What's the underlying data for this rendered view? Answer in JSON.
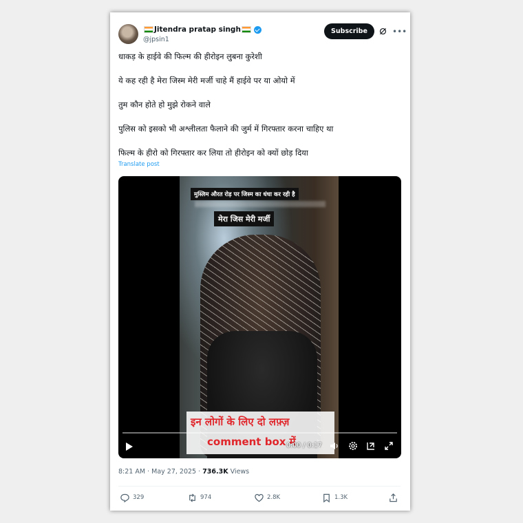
{
  "author": {
    "display_name": "Jitendra pratap singh",
    "handle": "@jpsin1",
    "verified": true
  },
  "subscribe_label": "Subscribe",
  "post": {
    "lines": [
      "धाकड़ के हाईवे की फिल्म की हीरोइन लुबना कुरेशी",
      "ये  कह रही है मेरा जिस्म  मेरी मर्जी चाहे मैं हाईवे पर या ओयो में",
      "तुम कौन होते हो मुझे रोकने वाले",
      "पुलिस को इसको भी अश्लीलता  फैलाने की जुर्म में गिरफ्तार करना चाहिए था",
      "फिल्म के हीरो को गिरफ्तार कर लिया तो हीरोइन को क्यों छोड़ दिया"
    ],
    "translate_label": "Translate post"
  },
  "video": {
    "caption_top": "मुस्लिम औरत रोड़ पर जिस्म का धंधा कर रही है",
    "caption_main": "मेरा जिस मेरी मर्जी",
    "bottom_line1": "इन लोगों के लिए दो लफ़्ज़",
    "bottom_line2": "comment box में",
    "time": "0:00 / 0:17",
    "progress": 0
  },
  "meta": {
    "time": "8:21 AM",
    "date": "May 27, 2025",
    "views_count": "736.3K",
    "views_label": "Views"
  },
  "actions": {
    "replies": "329",
    "reposts": "974",
    "likes": "2.8K",
    "bookmarks": "1.3K"
  },
  "colors": {
    "accent": "#1d9bf0",
    "text": "#0f1419",
    "muted": "#536471",
    "caption_red": "#e0262b"
  }
}
